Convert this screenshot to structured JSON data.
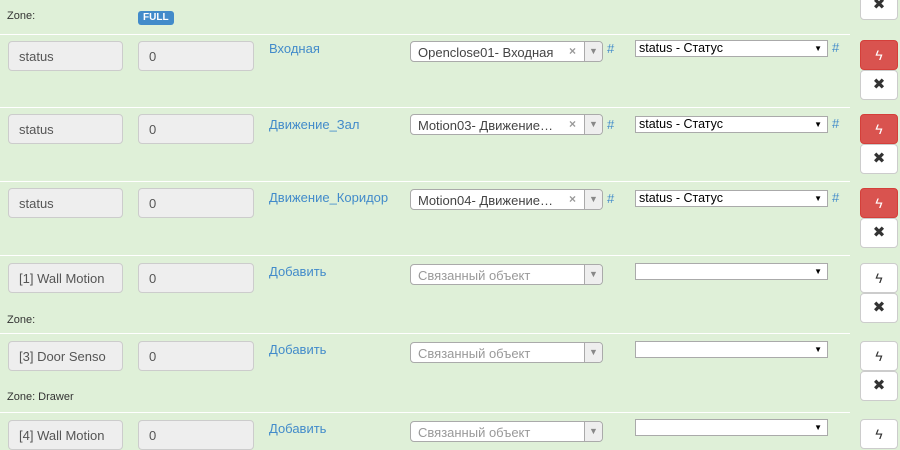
{
  "zones": {
    "zone_top": "Zone:",
    "full_badge": "FULL",
    "zone_mid": "Zone:",
    "zone_drawer": "Zone: Drawer"
  },
  "rows": [
    {
      "property": "status",
      "value": "0",
      "link": "Входная",
      "linked_object": "Openclose01- Входная",
      "property_select": "status - Статус",
      "hash": "#"
    },
    {
      "property": "status",
      "value": "0",
      "link": "Движение_Зал",
      "linked_object": "Motion03- Движение…",
      "property_select": "status - Статус",
      "hash": "#"
    },
    {
      "property": "status",
      "value": "0",
      "link": "Движение_Коридор",
      "linked_object": "Motion04- Движение…",
      "property_select": "status - Статус",
      "hash": "#"
    },
    {
      "property": "[1] Wall Motion",
      "value": "0",
      "link": "Добавить",
      "linked_object": "Связанный объект",
      "property_select": ""
    },
    {
      "property": "[3] Door Senso",
      "value": "0",
      "link": "Добавить",
      "linked_object": "Связанный объект",
      "property_select": ""
    },
    {
      "property": "[4] Wall Motion",
      "value": "0",
      "link": "Добавить",
      "linked_object": "Связанный объект",
      "property_select": ""
    }
  ],
  "icons": {
    "bolt": "bolt-icon",
    "close": "close-icon",
    "clear": "clear-x-icon",
    "dropdown": "chevron-down-icon"
  },
  "colors": {
    "background": "#dff0d8",
    "link": "#428bca",
    "danger": "#d9534f"
  }
}
